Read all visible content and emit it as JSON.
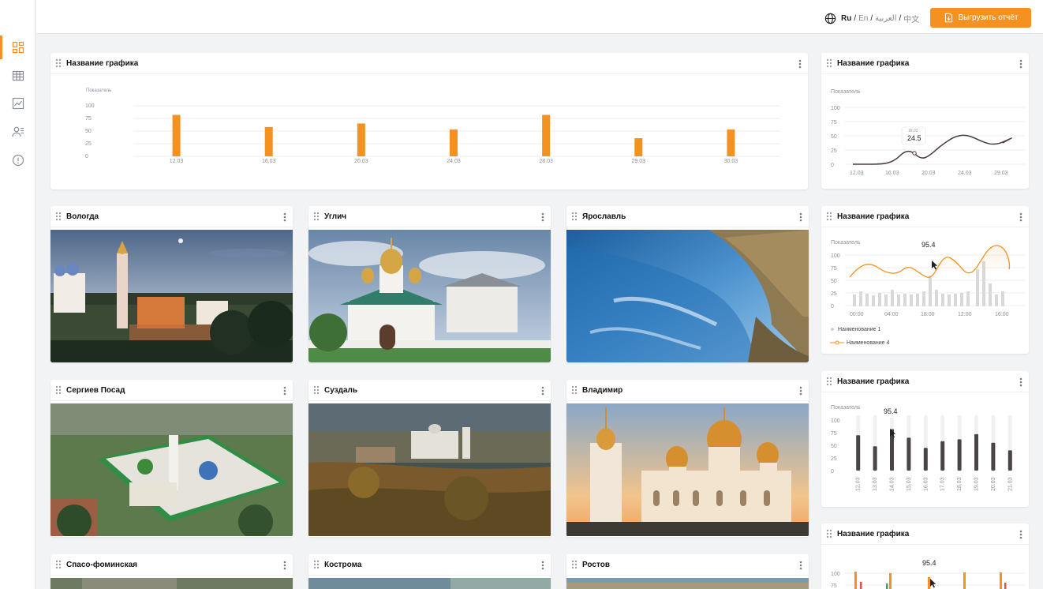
{
  "colors": {
    "accent": "#f39221",
    "line": "#4a3b3b",
    "bar_dark": "#4a4444"
  },
  "sidebar": {
    "items": [
      {
        "icon": "dashboard-icon",
        "active": true
      },
      {
        "icon": "table-icon",
        "active": false
      },
      {
        "icon": "line-chart-icon",
        "active": false
      },
      {
        "icon": "users-list-icon",
        "active": false
      },
      {
        "icon": "alert-circle-icon",
        "active": false
      }
    ]
  },
  "header": {
    "languages": [
      {
        "label": "Ru",
        "current": true
      },
      {
        "label": "En",
        "current": false
      },
      {
        "label": "العربية",
        "current": false
      },
      {
        "label": "中文",
        "current": false
      }
    ],
    "export_label": "Выгрузить отчёт"
  },
  "main_chart": {
    "title": "Название графика",
    "chart_data": {
      "type": "bar",
      "ylabel": "Показатель",
      "yticks": [
        "100",
        "75",
        "50",
        "25",
        "0"
      ],
      "ylim": [
        0,
        100
      ],
      "categories": [
        "12.03",
        "16.03",
        "20.03",
        "24.03",
        "28.03",
        "29.03",
        "30.03"
      ],
      "values": [
        82,
        58,
        65,
        53,
        82,
        36,
        53
      ]
    }
  },
  "cities": [
    {
      "name": "Вологда"
    },
    {
      "name": "Углич"
    },
    {
      "name": "Ярославль"
    },
    {
      "name": "Сергиев Посад"
    },
    {
      "name": "Суздаль"
    },
    {
      "name": "Владимир"
    },
    {
      "name": "Спасо-фоминская"
    },
    {
      "name": "Кострома"
    },
    {
      "name": "Ростов"
    }
  ],
  "widgets": [
    {
      "title": "Название графика",
      "chart_data": {
        "type": "line",
        "ylabel": "Показатель",
        "yticks": [
          "100",
          "75",
          "50",
          "25",
          "0"
        ],
        "ylim": [
          0,
          100
        ],
        "xticks": [
          "12.03",
          "16.03",
          "20.03",
          "24.03",
          "29.03"
        ],
        "tooltip": {
          "small": "18.03",
          "value": "24.5"
        }
      }
    },
    {
      "title": "Название графика",
      "chart_data": {
        "type": "line",
        "ylabel": "Показатель",
        "yticks": [
          "100",
          "75",
          "50",
          "25",
          "0"
        ],
        "ylim": [
          0,
          100
        ],
        "xticks": [
          "00:00",
          "04:00",
          "18:00",
          "12:00",
          "16:00"
        ],
        "tooltip": {
          "value": "95.4"
        },
        "series": [
          {
            "name": "Наименование 1",
            "type": "bar"
          },
          {
            "name": "Наименование 4",
            "type": "line"
          }
        ]
      }
    },
    {
      "title": "Название графика",
      "chart_data": {
        "type": "bar",
        "ylabel": "Показатель",
        "yticks": [
          "100",
          "75",
          "50",
          "25",
          "0"
        ],
        "ylim": [
          0,
          100
        ],
        "categories": [
          "12.03",
          "13.03",
          "14.03",
          "15.03",
          "16.03",
          "17.03",
          "18.03",
          "19.03",
          "20.03",
          "21.03"
        ],
        "values": [
          70,
          48,
          82,
          65,
          45,
          58,
          62,
          72,
          55,
          40
        ],
        "tooltip": {
          "value": "95.4"
        }
      }
    },
    {
      "title": "Название графика",
      "chart_data": {
        "type": "bar",
        "yticks": [
          "100",
          "75"
        ],
        "tooltip": {
          "value": "95.4"
        }
      }
    }
  ]
}
